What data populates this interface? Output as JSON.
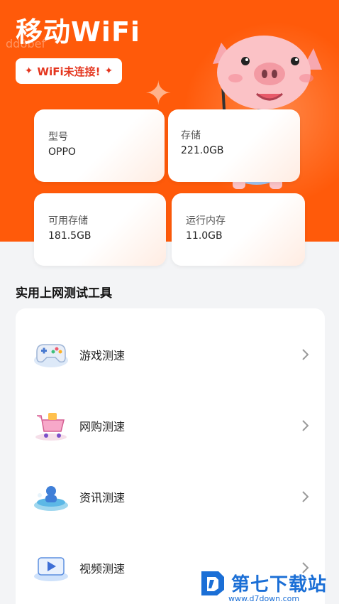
{
  "header": {
    "title": "移动WiFi",
    "watermark": "dd8bef",
    "wifi_status": "WiFi未连接!"
  },
  "device_info": [
    {
      "label": "型号",
      "value": "OPPO"
    },
    {
      "label": "存储",
      "value": "221.0GB"
    },
    {
      "label": "可用存储",
      "value": "181.5GB"
    },
    {
      "label": "运行内存",
      "value": "11.0GB"
    }
  ],
  "tools": {
    "section_title": "实用上网测试工具",
    "items": [
      {
        "label": "游戏测速",
        "icon": "gamepad-icon"
      },
      {
        "label": "网购测速",
        "icon": "shopping-cart-icon"
      },
      {
        "label": "资讯测速",
        "icon": "news-icon"
      },
      {
        "label": "视频测速",
        "icon": "video-play-icon"
      }
    ]
  },
  "footer_watermark": {
    "name": "第七下载站",
    "url": "www.d7down.com"
  },
  "colors": {
    "accent": "#ff5a0a",
    "status_text": "#e4361f",
    "brand_blue": "#1b6fd6"
  }
}
